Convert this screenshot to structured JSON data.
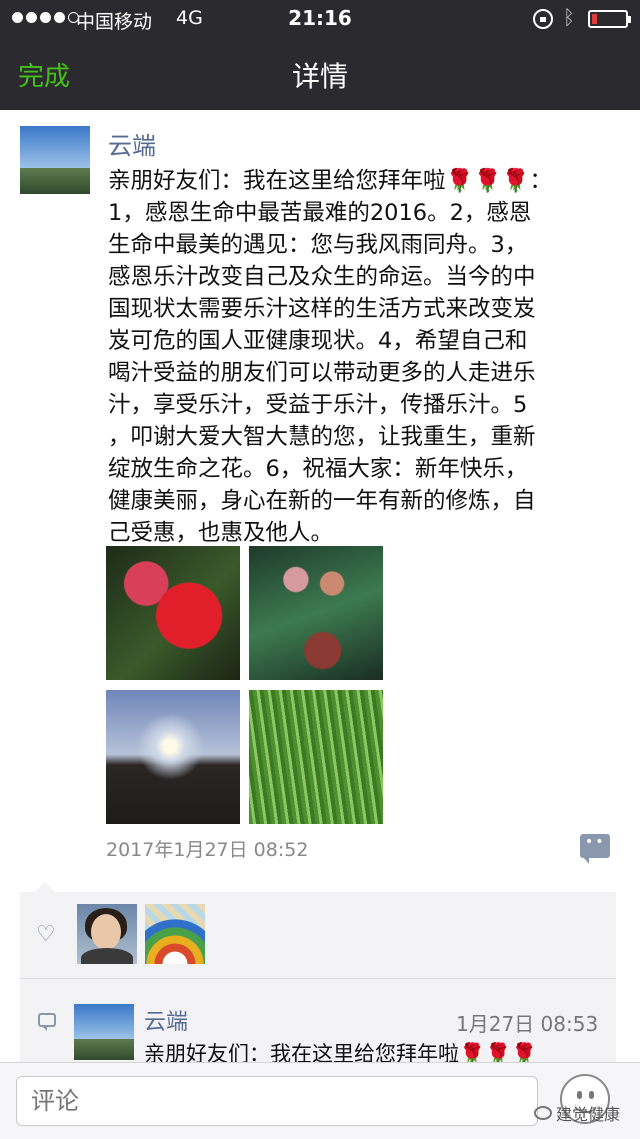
{
  "status_bar": {
    "carrier": "中国移动",
    "network": "4G",
    "time": "21:16",
    "battery_level": 0.15,
    "battery_color": "#e23b3b"
  },
  "nav": {
    "done_label": "完成",
    "title": "详情"
  },
  "post": {
    "author": "云端",
    "text": "亲朋好友们：我在这里给您拜年啦🌹🌹🌹：\n1，感恩生命中最苦最难的2016。2，感恩\n生命中最美的遇见：您与我风雨同舟。3，\n感恩乐汁改变自己及众生的命运。当今的中\n国现状太需要乐汁这样的生活方式来改变岌\n岌可危的国人亚健康现状。4，希望自己和\n喝汁受益的朋友们可以带动更多的人走进乐\n汁，享受乐汁，受益于乐汁，传播乐汁。5\n，叩谢大爱大智大慧的您，让我重生，重新\n绽放生命之花。6，祝福大家：新年快乐，\n健康美丽，身心在新的一年有新的修炼，自\n己受惠，也惠及他人。",
    "photos": [
      "red-anthurium-photo",
      "orchid-photo",
      "sunset-photo",
      "grass-photo"
    ],
    "timestamp": "2017年1月27日 08:52"
  },
  "likes": {
    "icon": "heart-icon",
    "avatars": [
      "liker-avatar-woman",
      "liker-avatar-rainbow"
    ]
  },
  "comment": {
    "author": "云端",
    "time": "1月27日 08:53",
    "text": "亲朋好友们：我在这里给您拜年啦🌹🌹🌹"
  },
  "input": {
    "placeholder": "评论"
  },
  "watermark": {
    "text": "建觉健康"
  },
  "colors": {
    "nav_background": "#2b2b2f",
    "done_green": "#45c01a",
    "name_blue": "#566a94"
  }
}
